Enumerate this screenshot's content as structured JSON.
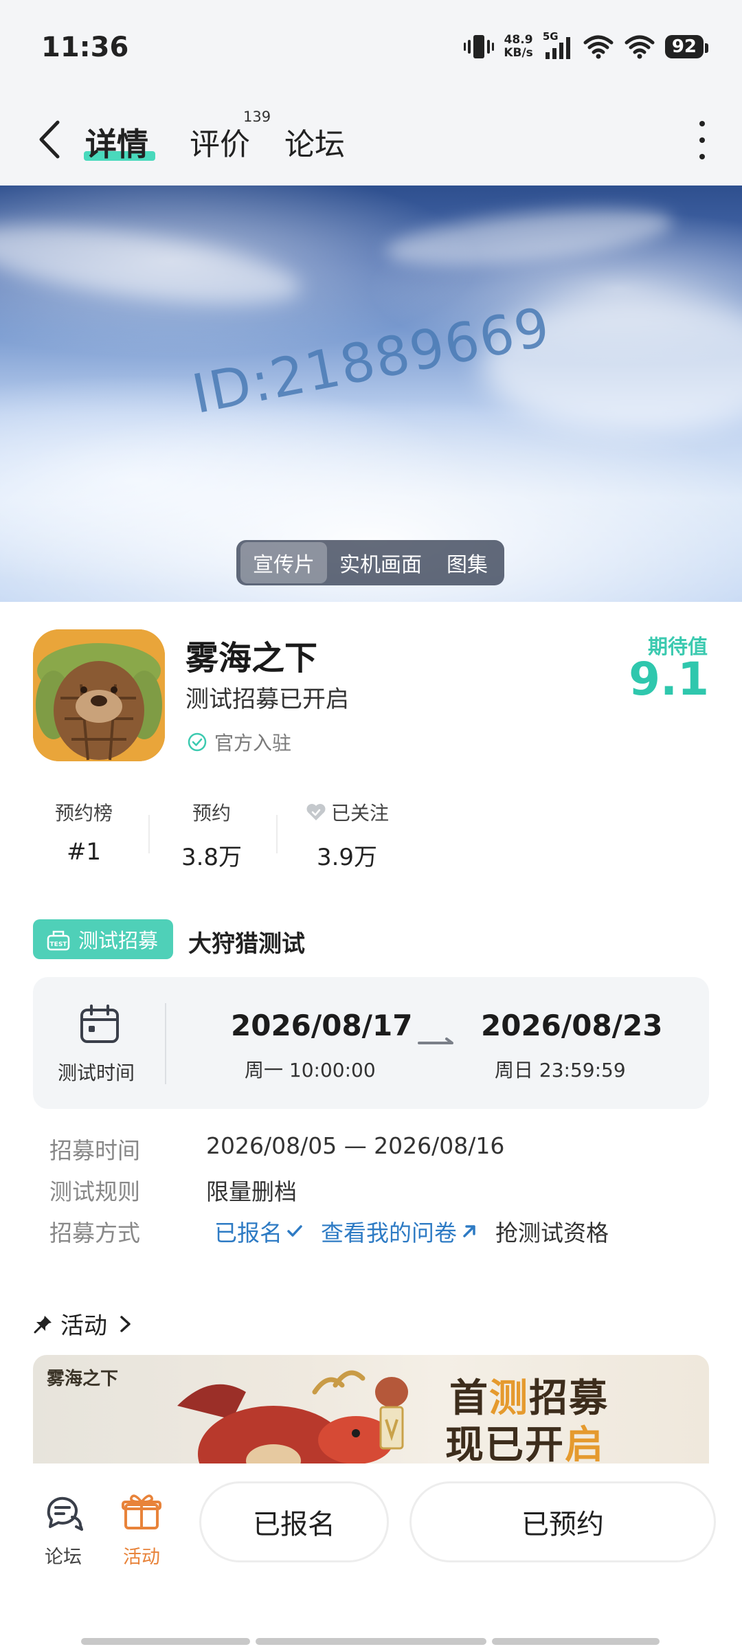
{
  "status_bar": {
    "time": "11:36",
    "net_speed_value": "48.9",
    "net_speed_unit": "KB/s",
    "signal_label": "5G",
    "battery": "92"
  },
  "nav": {
    "tabs": [
      "详情",
      "评价",
      "论坛"
    ],
    "review_count": "139"
  },
  "hero": {
    "watermark": "ID:21889669",
    "media_tabs": [
      "宣传片",
      "实机画面",
      "图集"
    ]
  },
  "game": {
    "title": "雾海之下",
    "subtitle": "测试招募已开启",
    "official": "官方入驻",
    "expect_label": "期待值",
    "expect_value": "9.1"
  },
  "stats": [
    {
      "label": "预约榜",
      "value": "#1"
    },
    {
      "label": "预约",
      "value": "3.8万"
    },
    {
      "label": "已关注",
      "value": "3.9万"
    }
  ],
  "test": {
    "badge": "测试招募",
    "name": "大狩猎测试",
    "time_label": "测试时间",
    "start_date": "2026/08/17",
    "start_time": "周一  10:00:00",
    "end_date": "2026/08/23",
    "end_time": "周日  23:59:59",
    "recruit_label": "招募时间",
    "recruit_value": "2026/08/05 — 2026/08/16",
    "rule_label": "测试规则",
    "rule_value": "限量删档",
    "method_label": "招募方式",
    "signed_up": "已报名",
    "questionnaire": "查看我的问卷",
    "grab": "抢测试资格"
  },
  "activity": {
    "heading": "活动",
    "banner_logo": "雾海之下",
    "banner_line1_a": "首",
    "banner_line1_b": "测",
    "banner_line1_c": "招募",
    "banner_line2_a": "现已开",
    "banner_line2_b": "启"
  },
  "bottom": {
    "forum": "论坛",
    "activity": "活动",
    "btn_signed": "已报名",
    "btn_reserved": "已预约"
  },
  "colors": {
    "accent_teal": "#2fc7ad",
    "link_blue": "#2e7bc4",
    "activity_orange": "#e8833a"
  }
}
